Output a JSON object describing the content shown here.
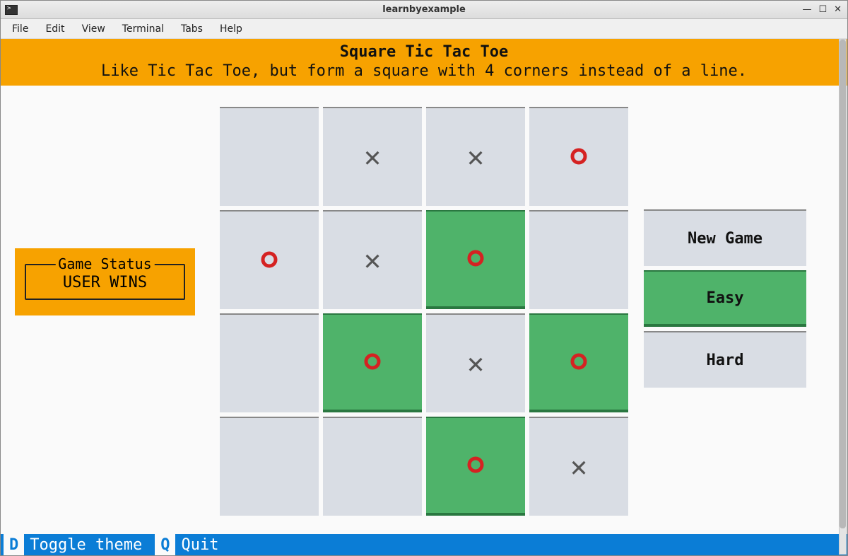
{
  "window": {
    "title": "learnbyexample"
  },
  "menubar": [
    "File",
    "Edit",
    "View",
    "Terminal",
    "Tabs",
    "Help"
  ],
  "header": {
    "title": "Square Tic Tac Toe",
    "subtitle": "Like Tic Tac Toe, but form a square with 4 corners instead of a line."
  },
  "status": {
    "legend": "Game Status",
    "text": "USER WINS"
  },
  "board": {
    "rows": 4,
    "cols": 4,
    "cells": [
      {
        "mark": "",
        "win": false
      },
      {
        "mark": "X",
        "win": false
      },
      {
        "mark": "X",
        "win": false
      },
      {
        "mark": "O",
        "win": false
      },
      {
        "mark": "O",
        "win": false
      },
      {
        "mark": "X",
        "win": false
      },
      {
        "mark": "O",
        "win": true
      },
      {
        "mark": "",
        "win": false
      },
      {
        "mark": "",
        "win": false
      },
      {
        "mark": "O",
        "win": true
      },
      {
        "mark": "X",
        "win": false
      },
      {
        "mark": "O",
        "win": true
      },
      {
        "mark": "",
        "win": false
      },
      {
        "mark": "",
        "win": false
      },
      {
        "mark": "O",
        "win": true
      },
      {
        "mark": "X",
        "win": false
      }
    ]
  },
  "side": [
    {
      "label": "New Game",
      "active": false
    },
    {
      "label": "Easy",
      "active": true
    },
    {
      "label": "Hard",
      "active": false
    }
  ],
  "footer": [
    {
      "key": "D",
      "label": "Toggle theme"
    },
    {
      "key": "Q",
      "label": "Quit"
    }
  ],
  "glyphs": {
    "X": "✕",
    "O": "○"
  }
}
